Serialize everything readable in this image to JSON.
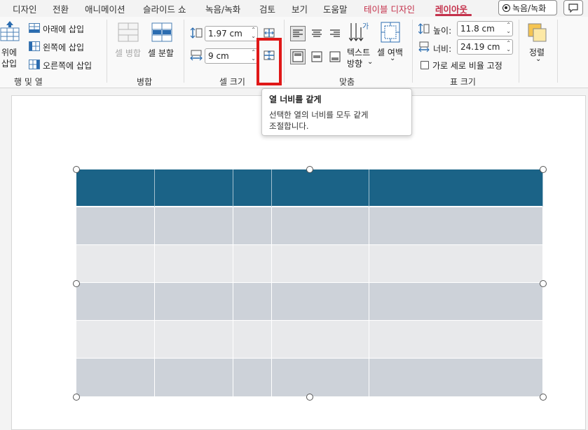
{
  "tabs": {
    "design": "디자인",
    "transitions": "전환",
    "animations": "애니메이션",
    "slideshow": "슬라이드 쇼",
    "record": "녹음/녹화",
    "review": "검토",
    "view": "보기",
    "help": "도움말",
    "table_design": "테이블 디자인",
    "layout": "레이아웃"
  },
  "record_button": "녹음/녹화",
  "ribbon": {
    "rows_cols": {
      "insert_above_line1": "위에",
      "insert_above_line2": "삽입",
      "insert_below": "아래에 삽입",
      "insert_left": "왼쪽에 삽입",
      "insert_right": "오른쪽에 삽입",
      "group_label": "행 및 열"
    },
    "merge": {
      "merge_cells": "셀 병합",
      "split_cells": "셀 분할",
      "group_label": "병합"
    },
    "cell_size": {
      "height_value": "1.97 cm",
      "width_value": "9 cm",
      "group_label": "셀 크기"
    },
    "alignment": {
      "text_direction_line1": "텍스트",
      "text_direction_line2": "방향",
      "cell_margins": "셀 여백",
      "group_label": "맞춤"
    },
    "table_size": {
      "height_label": "높이:",
      "height_value": "11.8 cm",
      "width_label": "너비:",
      "width_value": "24.19 cm",
      "lock_aspect": "가로 세로 비율 고정",
      "group_label": "표 크기"
    },
    "arrange": {
      "label": "정렬"
    }
  },
  "tooltip": {
    "title": "열 너비를 같게",
    "line1": "선택한 열의 너비를 모두 같게",
    "line2": "조절합니다."
  },
  "table": {
    "header_color": "#1b6387",
    "band_dark": "#cdd2d9",
    "band_light": "#e8e9eb",
    "rows": 6,
    "cols": 5
  },
  "colors": {
    "accent": "#c4314b",
    "highlight_box": "#e01818"
  }
}
